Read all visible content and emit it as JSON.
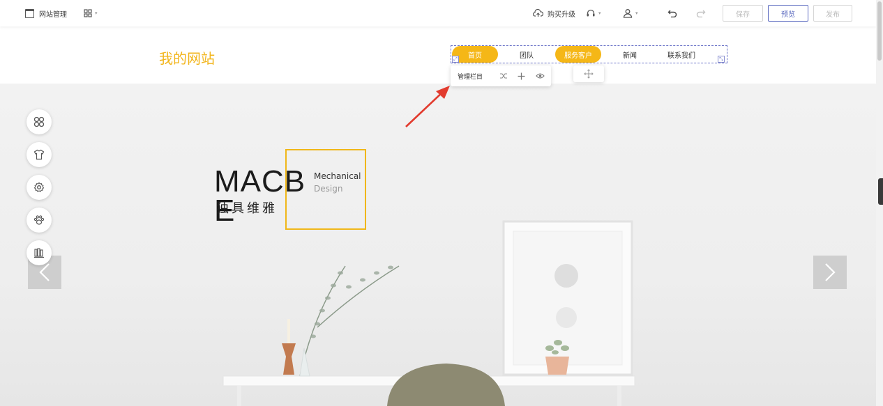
{
  "topbar": {
    "site_manage_label": "网站管理",
    "buy_upgrade_label": "购买升级",
    "save_label": "保存",
    "preview_label": "预览",
    "publish_label": "发布"
  },
  "site": {
    "title": "我的网站",
    "nav_items": [
      {
        "label": "首页",
        "active": true
      },
      {
        "label": "团队",
        "active": false
      },
      {
        "label": "服务客户",
        "active": true
      },
      {
        "label": "新闻",
        "active": false
      },
      {
        "label": "联系我们",
        "active": false
      }
    ]
  },
  "nav_toolbar": {
    "manage_label": "管理栏目"
  },
  "banner": {
    "brand": "MACBE",
    "slogan": "独具维雅",
    "mechanical": "Mechanical",
    "design": "Design"
  },
  "left_tools": [
    {
      "icon": "grid-icon"
    },
    {
      "icon": "tshirt-icon"
    },
    {
      "icon": "gear-icon"
    },
    {
      "icon": "paw-icon"
    },
    {
      "icon": "books-icon"
    }
  ],
  "colors": {
    "accent": "#f5b717",
    "title": "#f2b51c",
    "selection": "#6b74c8",
    "annotation_arrow": "#e23b2e"
  }
}
